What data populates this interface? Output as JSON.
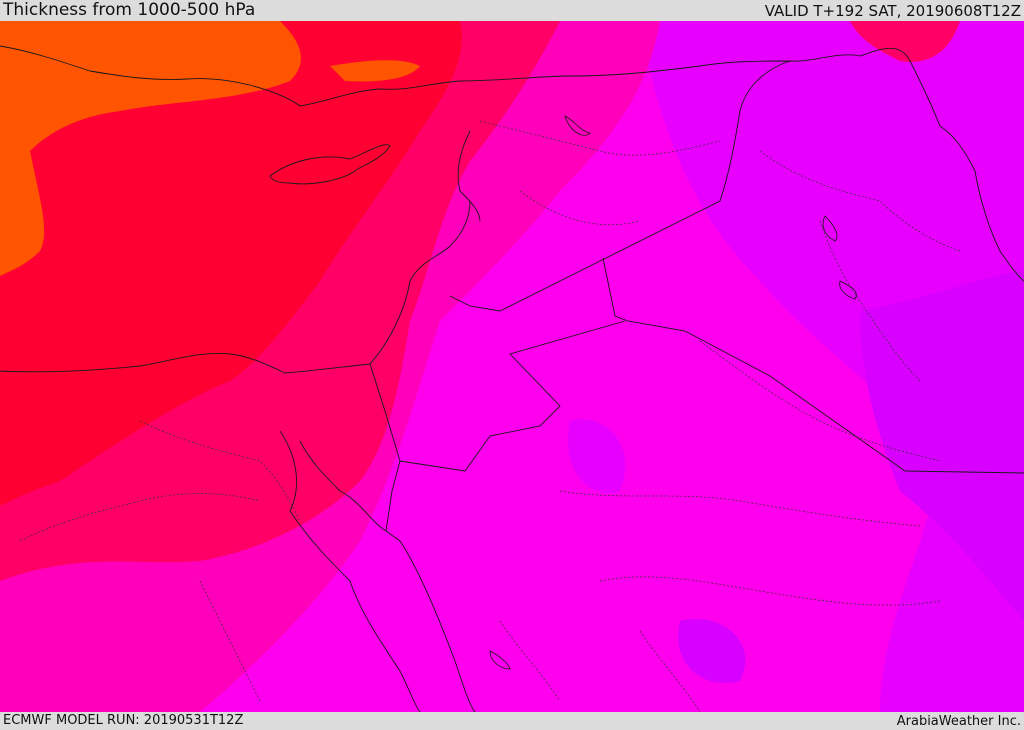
{
  "header": {
    "title": "Thickness from 1000-500 hPa",
    "valid": "VALID T+192 SAT, 20190608T12Z"
  },
  "footer": {
    "model_run": "ECMWF MODEL RUN: 20190531T12Z",
    "credit": "ArabiaWeather Inc."
  },
  "map": {
    "field": "thickness-1000-500hPa",
    "region": "Eastern Mediterranean and Middle East",
    "color_scale": [
      "#ff5500",
      "#ff0033",
      "#ff0066",
      "#ff00bb",
      "#ff00ee",
      "#d800ff"
    ]
  }
}
